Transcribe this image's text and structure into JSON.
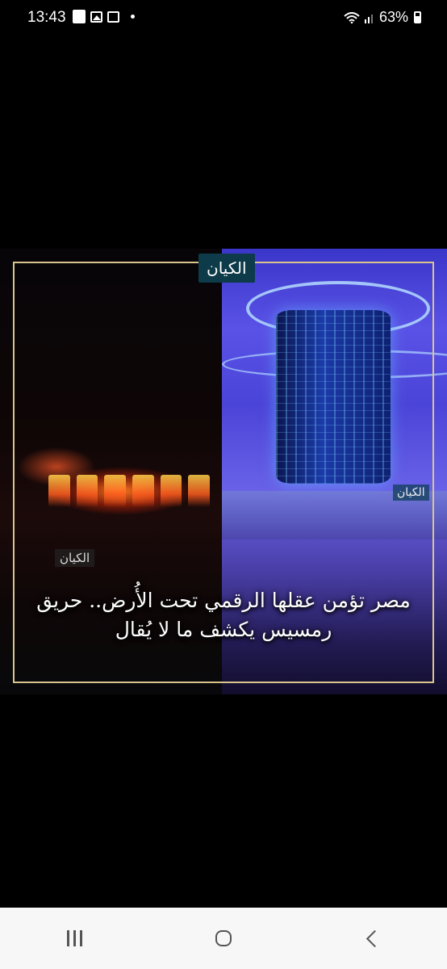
{
  "status_bar": {
    "time": "13:43",
    "battery": "63%",
    "notification_icons": [
      "puzzle-icon",
      "image-icon",
      "news-icon",
      "dot-icon"
    ],
    "system_icons": [
      "wifi-icon",
      "signal-icon",
      "battery-icon"
    ]
  },
  "post": {
    "brand": "الكيان",
    "watermark_left": "الكيان",
    "watermark_right": "الكيان",
    "caption": "مصر تؤمن عقلها الرقمي تحت الأُرض.. حريق رمسيس يكشف ما لا يُقال"
  },
  "nav_bar": {
    "buttons": [
      "recents-button",
      "home-button",
      "back-button"
    ]
  }
}
